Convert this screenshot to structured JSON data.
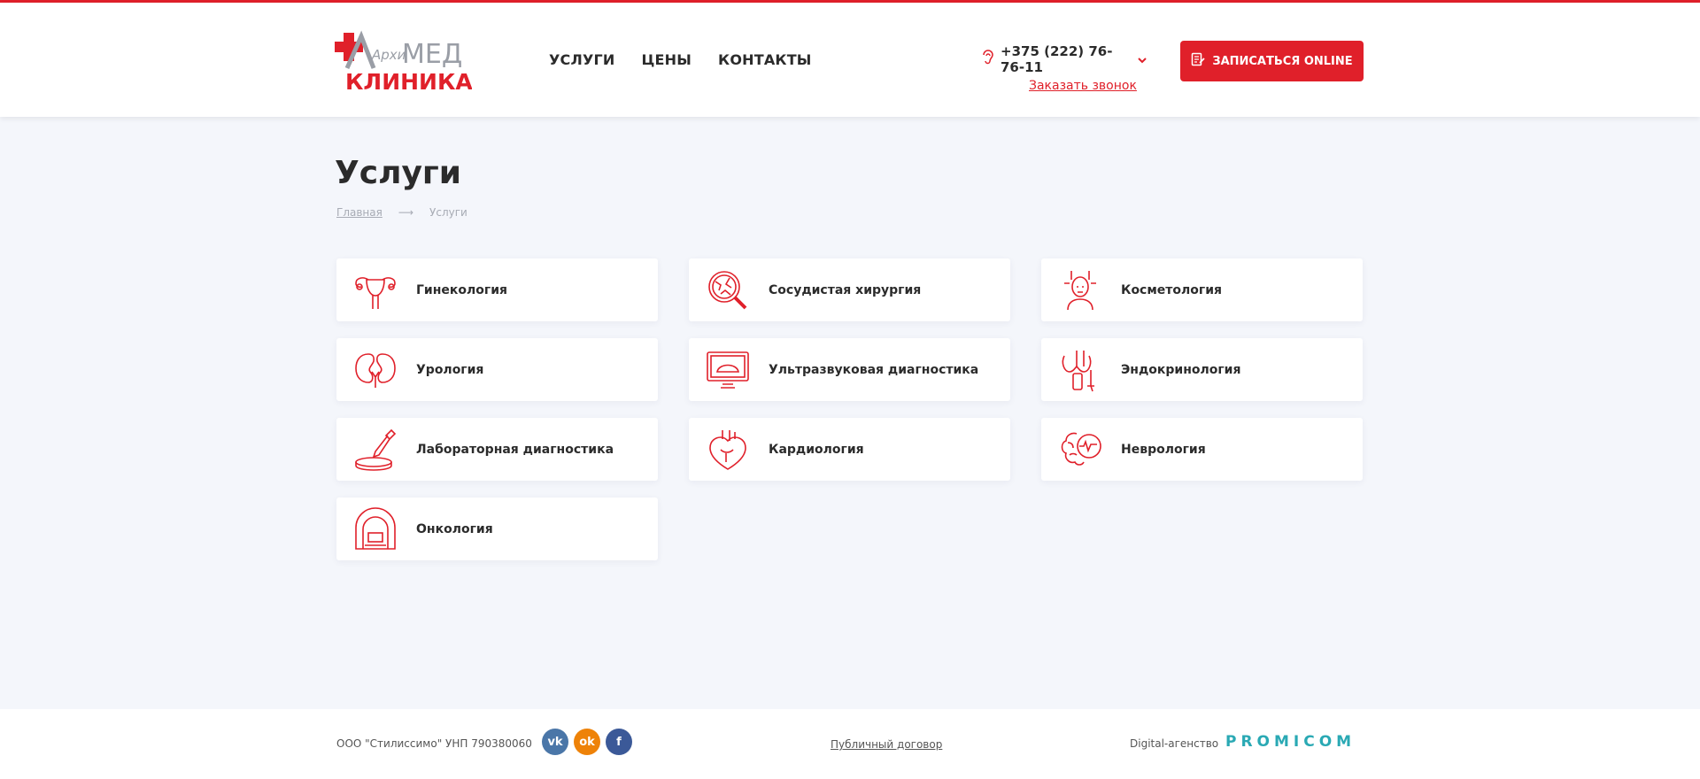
{
  "colors": {
    "accent": "#e0202a",
    "text": "#2b2b2b",
    "muted": "#a7abb4",
    "background": "#f4f6fb",
    "vk": "#4a76a8",
    "ok": "#ee8208",
    "fb": "#3b5998",
    "promicom": "#2aa9b4"
  },
  "logo": {
    "text_top_prefix": "Архи",
    "text_top_suffix": "МЕД",
    "text_bottom": "КЛИНИКА"
  },
  "nav": {
    "items": [
      "УСЛУГИ",
      "ЦЕНЫ",
      "КОНТАКТЫ"
    ]
  },
  "contact": {
    "phone": "+375 (222) 76-76-11",
    "callback": "Заказать звонок",
    "phone_icon": "ear-phone-icon",
    "dropdown_icon": "chevron-down-icon"
  },
  "cta": {
    "label": "ЗАПИСАТЬСЯ ONLINE",
    "icon": "form-edit-icon"
  },
  "page": {
    "title": "Услуги"
  },
  "breadcrumb": {
    "home": "Главная",
    "separator": "⟶",
    "current": "Услуги"
  },
  "services": [
    {
      "label": "Гинекология",
      "icon": "uterus-icon"
    },
    {
      "label": "Сосудистая хирургия",
      "icon": "vessel-magnifier-icon"
    },
    {
      "label": "Косметология",
      "icon": "face-treatment-icon"
    },
    {
      "label": "Урология",
      "icon": "kidneys-icon"
    },
    {
      "label": "Ультразвуковая диагностика",
      "icon": "ultrasound-monitor-icon"
    },
    {
      "label": "Эндокринология",
      "icon": "thyroid-icon"
    },
    {
      "label": "Лабораторная диагностика",
      "icon": "pipette-dish-icon"
    },
    {
      "label": "Кардиология",
      "icon": "heart-icon"
    },
    {
      "label": "Неврология",
      "icon": "brain-pulse-icon"
    },
    {
      "label": "Онкология",
      "icon": "ct-scanner-icon"
    }
  ],
  "footer": {
    "legal": "ООО \"Стилиссимо\" УНП 790380060",
    "socials": [
      {
        "name": "vk",
        "glyph": "vk"
      },
      {
        "name": "ok",
        "glyph": "ok"
      },
      {
        "name": "facebook",
        "glyph": "f"
      }
    ],
    "contract": "Публичный договор",
    "agency_label": "Digital-агенство",
    "agency_name": "PROMICOM"
  }
}
